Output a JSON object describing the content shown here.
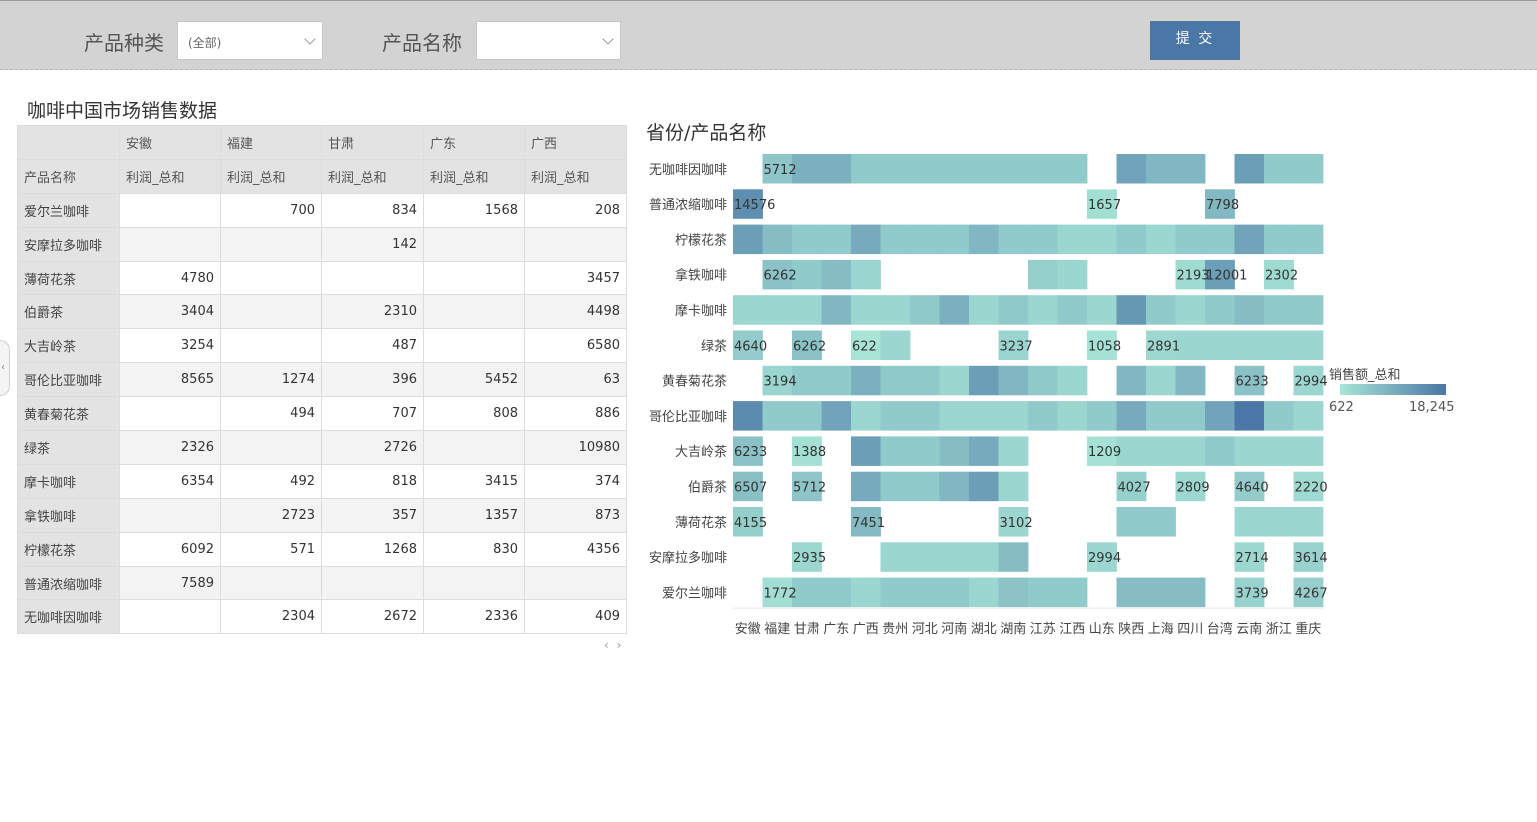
{
  "filters": {
    "category_label": "产品种类",
    "category_value": "(全部)",
    "product_label": "产品名称",
    "product_value": "",
    "submit_label": "提 交"
  },
  "table": {
    "title": "咖啡中国市场销售数据",
    "provinces": [
      "安徽",
      "福建",
      "甘肃",
      "广东",
      "广西"
    ],
    "row_header_label": "产品名称",
    "measure_label": "利润_总和",
    "rows": [
      {
        "name": "爱尔兰咖啡",
        "values": [
          "",
          "700",
          "834",
          "1568",
          "208"
        ]
      },
      {
        "name": "安摩拉多咖啡",
        "values": [
          "",
          "",
          "142",
          "",
          ""
        ]
      },
      {
        "name": "薄荷花茶",
        "values": [
          "4780",
          "",
          "",
          "",
          "3457"
        ]
      },
      {
        "name": "伯爵茶",
        "values": [
          "3404",
          "",
          "2310",
          "",
          "4498"
        ]
      },
      {
        "name": "大吉岭茶",
        "values": [
          "3254",
          "",
          "487",
          "",
          "6580"
        ]
      },
      {
        "name": "哥伦比亚咖啡",
        "values": [
          "8565",
          "1274",
          "396",
          "5452",
          "63"
        ]
      },
      {
        "name": "黄春菊花茶",
        "values": [
          "",
          "494",
          "707",
          "808",
          "886"
        ]
      },
      {
        "name": "绿茶",
        "values": [
          "2326",
          "",
          "2726",
          "",
          "10980"
        ]
      },
      {
        "name": "摩卡咖啡",
        "values": [
          "6354",
          "492",
          "818",
          "3415",
          "374"
        ]
      },
      {
        "name": "拿铁咖啡",
        "values": [
          "",
          "2723",
          "357",
          "1357",
          "873"
        ]
      },
      {
        "name": "柠檬花茶",
        "values": [
          "6092",
          "571",
          "1268",
          "830",
          "4356"
        ]
      },
      {
        "name": "普通浓缩咖啡",
        "values": [
          "7589",
          "",
          "",
          "",
          ""
        ]
      },
      {
        "name": "无咖啡因咖啡",
        "values": [
          "",
          "2304",
          "2672",
          "2336",
          "409"
        ]
      }
    ],
    "scroll_arrows": "‹ ›"
  },
  "chart": {
    "title": "省份/产品名称",
    "legend_title": "销售额_总和",
    "legend_min": "622",
    "legend_max": "18,245",
    "color_low": "#a8e5d6",
    "color_high": "#4a77a6"
  },
  "chart_data": {
    "type": "heatmap",
    "title": "省份/产品名称",
    "x": [
      "安徽",
      "福建",
      "甘肃",
      "广东",
      "广西",
      "贵州",
      "河北",
      "河南",
      "湖北",
      "湖南",
      "江苏",
      "江西",
      "山东",
      "陕西",
      "上海",
      "四川",
      "台湾",
      "云南",
      "浙江",
      "重庆"
    ],
    "y": [
      "无咖啡因咖啡",
      "普通浓缩咖啡",
      "柠檬花茶",
      "拿铁咖啡",
      "摩卡咖啡",
      "绿茶",
      "黄春菊花茶",
      "哥伦比亚咖啡",
      "大吉岭茶",
      "伯爵茶",
      "薄荷花茶",
      "安摩拉多咖啡",
      "爱尔兰咖啡"
    ],
    "legend": "销售额_总和",
    "color_range": [
      622,
      18245
    ],
    "values": [
      [
        null,
        5712,
        9000,
        9000,
        5000,
        5000,
        5000,
        5000,
        5000,
        5000,
        5000,
        5000,
        null,
        11000,
        8000,
        8000,
        null,
        12000,
        5000,
        5000
      ],
      [
        14576,
        null,
        null,
        null,
        null,
        null,
        null,
        null,
        null,
        null,
        null,
        null,
        1657,
        null,
        null,
        null,
        7798,
        null,
        null,
        null
      ],
      [
        12000,
        7000,
        5000,
        5000,
        10000,
        5000,
        5000,
        5000,
        8000,
        5000,
        5000,
        3000,
        3000,
        5000,
        3000,
        5000,
        5000,
        11000,
        5000,
        5000
      ],
      [
        null,
        6262,
        5000,
        7000,
        3000,
        null,
        null,
        null,
        null,
        null,
        4000,
        3000,
        null,
        null,
        null,
        2193,
        12001,
        null,
        2302,
        null
      ],
      [
        3000,
        3000,
        3000,
        8000,
        3000,
        3000,
        5000,
        9000,
        3000,
        5000,
        3000,
        5000,
        3000,
        13000,
        5000,
        3000,
        5000,
        7000,
        5000,
        5000
      ],
      [
        4640,
        null,
        6262,
        null,
        622,
        3000,
        null,
        null,
        null,
        3237,
        null,
        null,
        1058,
        null,
        2891,
        3000,
        3000,
        3000,
        3000,
        3000
      ],
      [
        null,
        3194,
        5000,
        5000,
        9000,
        5000,
        5000,
        3000,
        12000,
        8000,
        5000,
        3000,
        null,
        8000,
        3000,
        8000,
        null,
        6233,
        null,
        2994
      ],
      [
        15000,
        5000,
        5000,
        11000,
        3000,
        5000,
        5000,
        3000,
        3000,
        3000,
        5000,
        3000,
        5000,
        10000,
        5000,
        5000,
        11000,
        18245,
        5000,
        3000
      ],
      [
        6233,
        null,
        1388,
        null,
        12000,
        5000,
        5000,
        7000,
        10000,
        3000,
        null,
        null,
        1209,
        3000,
        3000,
        3000,
        5000,
        3000,
        3000,
        3000
      ],
      [
        6507,
        null,
        5712,
        null,
        10000,
        5000,
        5000,
        8000,
        12000,
        3000,
        null,
        null,
        null,
        4027,
        null,
        2809,
        null,
        4640,
        null,
        2220
      ],
      [
        4155,
        null,
        null,
        null,
        7451,
        null,
        null,
        null,
        null,
        3102,
        null,
        null,
        null,
        5000,
        5000,
        null,
        null,
        3000,
        3000,
        3000
      ],
      [
        null,
        null,
        2935,
        null,
        null,
        3000,
        3000,
        3000,
        3000,
        7000,
        null,
        null,
        2994,
        null,
        null,
        null,
        null,
        2714,
        null,
        3614
      ],
      [
        null,
        1772,
        5000,
        5000,
        3000,
        5000,
        5000,
        5000,
        3000,
        6000,
        5000,
        5000,
        null,
        7000,
        7000,
        7000,
        null,
        3739,
        null,
        4267
      ]
    ],
    "data_labels": [
      [
        null,
        "5712",
        null,
        null,
        null,
        null,
        null,
        null,
        null,
        null,
        null,
        null,
        null,
        null,
        null,
        null,
        null,
        null,
        null,
        null
      ],
      [
        "14576",
        null,
        null,
        null,
        null,
        null,
        null,
        null,
        null,
        null,
        null,
        null,
        "1657",
        null,
        null,
        null,
        "7798",
        null,
        null,
        null
      ],
      [
        null,
        null,
        null,
        null,
        null,
        null,
        null,
        null,
        null,
        null,
        null,
        null,
        null,
        null,
        null,
        null,
        null,
        null,
        null,
        null
      ],
      [
        null,
        "6262",
        null,
        null,
        null,
        null,
        null,
        null,
        null,
        null,
        null,
        null,
        null,
        null,
        null,
        "2193",
        "12001",
        null,
        "2302",
        null
      ],
      [
        null,
        null,
        null,
        null,
        null,
        null,
        null,
        null,
        null,
        null,
        null,
        null,
        null,
        null,
        null,
        null,
        null,
        null,
        null,
        null
      ],
      [
        "4640",
        null,
        "6262",
        null,
        "622",
        null,
        null,
        null,
        null,
        "3237",
        null,
        null,
        "1058",
        null,
        "2891",
        null,
        null,
        null,
        null,
        null
      ],
      [
        null,
        "3194",
        null,
        null,
        null,
        null,
        null,
        null,
        null,
        null,
        null,
        null,
        null,
        null,
        null,
        null,
        null,
        "6233",
        null,
        "2994"
      ],
      [
        null,
        null,
        null,
        null,
        null,
        null,
        null,
        null,
        null,
        null,
        null,
        null,
        null,
        null,
        null,
        null,
        null,
        null,
        null,
        null
      ],
      [
        "6233",
        null,
        "1388",
        null,
        null,
        null,
        null,
        null,
        null,
        null,
        null,
        null,
        "1209",
        null,
        null,
        null,
        null,
        null,
        null,
        null
      ],
      [
        "6507",
        null,
        "5712",
        null,
        null,
        null,
        null,
        null,
        null,
        null,
        null,
        null,
        null,
        "4027",
        null,
        "2809",
        null,
        "4640",
        null,
        "2220"
      ],
      [
        "4155",
        null,
        null,
        null,
        "7451",
        null,
        null,
        null,
        null,
        "3102",
        null,
        null,
        null,
        null,
        null,
        null,
        null,
        null,
        null,
        null
      ],
      [
        null,
        null,
        "2935",
        null,
        null,
        null,
        null,
        null,
        null,
        null,
        null,
        null,
        "2994",
        null,
        null,
        null,
        null,
        "2714",
        null,
        "3614"
      ],
      [
        null,
        "1772",
        null,
        null,
        null,
        null,
        null,
        null,
        null,
        null,
        null,
        null,
        null,
        null,
        null,
        null,
        null,
        "3739",
        null,
        "4267"
      ]
    ]
  }
}
